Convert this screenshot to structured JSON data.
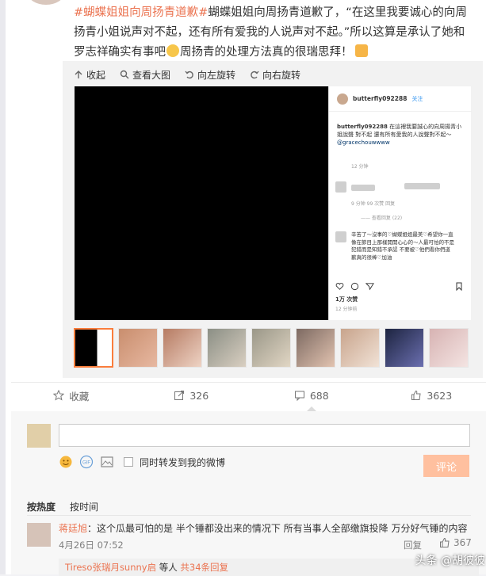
{
  "post": {
    "topic_1": "#蝴蝶姐姐向周扬青道歉#",
    "text_1": "蝴蝶姐姐向周扬青道歉了，“在这里我要诚心的向周扬青小姐说声对不起，还有所有爱我的人说声对不起。”所以这算是承认了她和罗志祥确实有事吧",
    "text_2": "周扬青的处理方法真的很瑞思拜！"
  },
  "media_tools": {
    "collapse": "收起",
    "view_large": "查看大图",
    "rotate_left": "向左旋转",
    "rotate_right": "向右旋转"
  },
  "instagram": {
    "username": "butterfly092288",
    "follow": "关注",
    "caption_user": "butterfly092288",
    "caption": "在這裡我要誠心的向周揚青小姐說聲 對不起 還有所有愛我的人說聲對不起～",
    "tag": "@gracechouwwww",
    "caption_time": "12 分钟",
    "comment_meta": "9 分钟    99 次赞    回复",
    "view_replies": "—— 查看回复 (22)",
    "comment": "辛苦了～沒事的♡蝴蝶姐姐最美♡希望你一直像在節目上那樣開開心心的～人最可怕的不是犯錯而是知錯不承認 不要被♡他們看你們道歉真的很棒♡加油",
    "likes": "1万 次赞",
    "date": "12 分钟前"
  },
  "actions": {
    "favorite": "收藏",
    "repost": "326",
    "comment": "688",
    "like": "3623"
  },
  "comment_box": {
    "placeholder": "",
    "also_repost": "同时转发到我的微博",
    "submit": "评论"
  },
  "sort": {
    "hot": "按热度",
    "time": "按时间"
  },
  "top_comment": {
    "name": "蒋廷旭",
    "text": "：这个瓜最可怕的是 半个锤都没出来的情况下 所有当事人全部缴旗投降 万分好气锤的内容",
    "time": "4月26日 07:52",
    "reply": "回复",
    "likes": "367"
  },
  "sub_comment": {
    "name": "Tireso张瑞月sunny启",
    "text": " 等人",
    "count": "共34条回复"
  },
  "watermark": "头条 @胡彼彼",
  "colors": {
    "topic": "#eb7350",
    "submit_bg": "#ffc09f",
    "active_thumb": "#fa7d3c"
  }
}
